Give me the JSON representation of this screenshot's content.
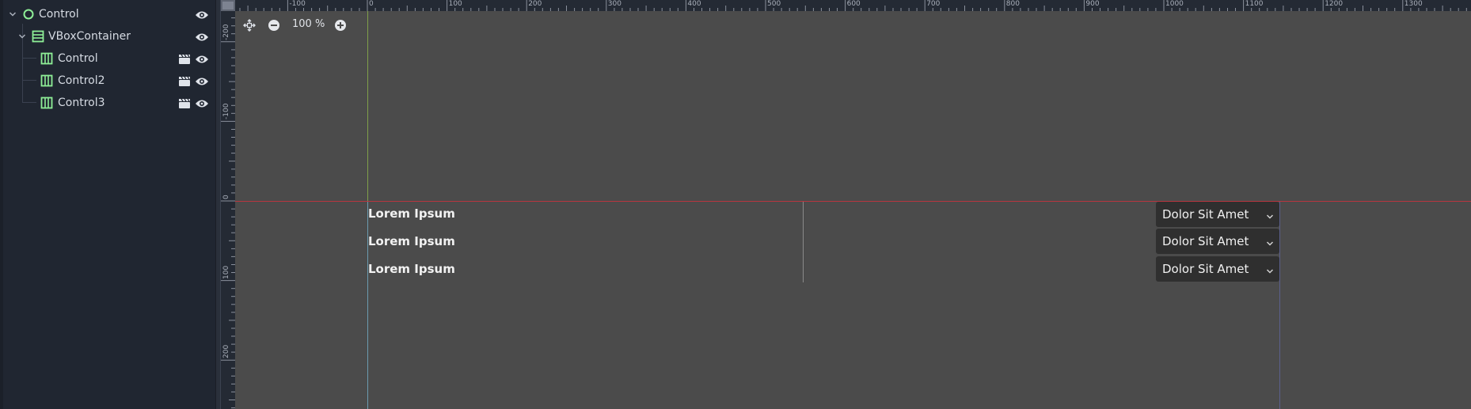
{
  "scene_tree": {
    "nodes": [
      {
        "label": "Control",
        "type": "control-root"
      },
      {
        "label": "VBoxContainer",
        "type": "vbox"
      },
      {
        "label": "Control",
        "type": "hbox"
      },
      {
        "label": "Control2",
        "type": "hbox"
      },
      {
        "label": "Control3",
        "type": "hbox"
      }
    ]
  },
  "viewport": {
    "zoom_label": "100 %",
    "ruler_top": [
      "-100",
      "0",
      "100",
      "200",
      "300",
      "400",
      "500",
      "600",
      "700",
      "800",
      "900",
      "1000",
      "1100",
      "1200",
      "1300"
    ],
    "ruler_left": [
      "-200",
      "-100",
      "0",
      "100",
      "200"
    ],
    "rows": [
      {
        "label": "Lorem Ipsum",
        "option": "Dolor Sit Amet"
      },
      {
        "label": "Lorem Ipsum",
        "option": "Dolor Sit Amet"
      },
      {
        "label": "Lorem Ipsum",
        "option": "Dolor Sit Amet"
      }
    ]
  },
  "colors": {
    "node_green": "#8eef97",
    "eye": "#dfe3ea",
    "axis_x": "#b8353f",
    "axis_y": "#7fa04a"
  }
}
